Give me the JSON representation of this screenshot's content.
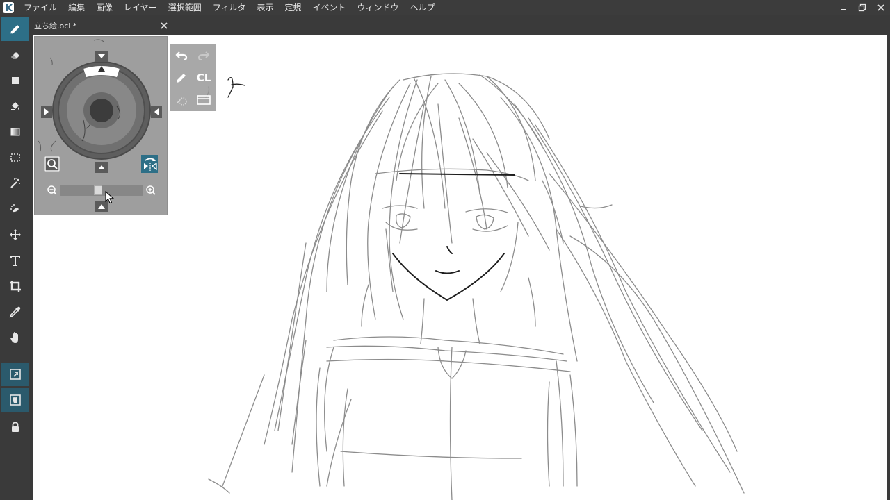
{
  "app": {
    "logo_icon": "app-logo-icon",
    "accent_color": "#2d6f87"
  },
  "menu": {
    "items": [
      "ファイル",
      "編集",
      "画像",
      "レイヤー",
      "選択範囲",
      "フィルタ",
      "表示",
      "定規",
      "イベント",
      "ウィンドウ",
      "ヘルプ"
    ]
  },
  "window_controls": [
    "minimize-icon",
    "restore-icon",
    "close-icon"
  ],
  "document": {
    "title": "立ち絵.oci *"
  },
  "toolbar": {
    "tools": [
      {
        "name": "pen-icon",
        "active": true
      },
      {
        "name": "eraser-icon"
      },
      {
        "name": "rectangle-icon"
      },
      {
        "name": "bucket-fill-icon"
      },
      {
        "name": "gradient-icon"
      },
      {
        "name": "selection-rect-icon"
      },
      {
        "name": "magic-wand-icon"
      },
      {
        "name": "selection-brush-icon"
      },
      {
        "name": "move-icon"
      },
      {
        "name": "text-icon"
      },
      {
        "name": "crop-icon"
      },
      {
        "name": "eyedropper-icon"
      },
      {
        "name": "hand-icon"
      }
    ],
    "toggles": [
      "external-link-icon",
      "palm-rejection-icon",
      "lock-icon"
    ]
  },
  "navigator": {
    "zoom_level": 0.45,
    "icons": [
      "zoom-fit-icon",
      "flip-horizontal-icon",
      "zoom-out-icon",
      "zoom-in-icon"
    ]
  },
  "quick_panel": {
    "clear_label": "CL",
    "icons": [
      "undo-icon",
      "redo-icon",
      "pen-icon",
      "clear-icon",
      "selection-dotted-icon",
      "frame-icon"
    ]
  }
}
